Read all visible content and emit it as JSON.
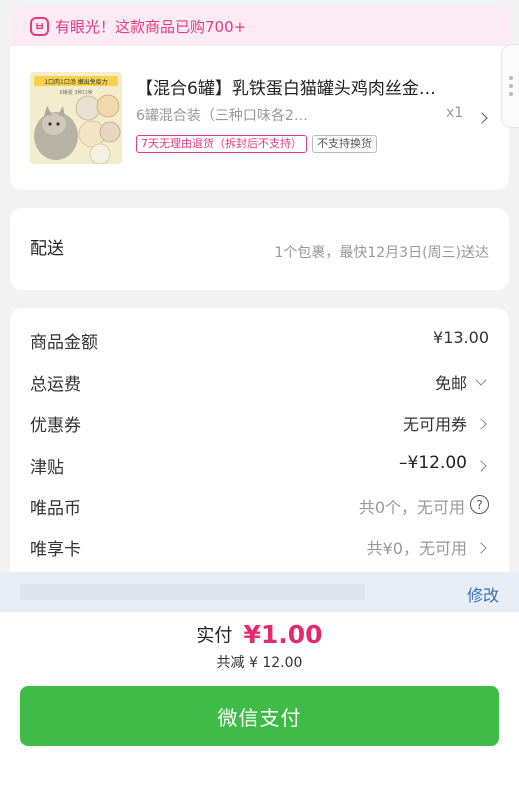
{
  "promo": {
    "icon": "smile-badge-icon",
    "text": "有眼光！这款商品已购700+"
  },
  "product": {
    "title": "【混合6罐】乳铁蛋白猫罐头鸡肉丝金…",
    "spec": "6罐混合装（三种口味各2…",
    "quantity": "x1",
    "tags": [
      "7天无理由退货（拆封后不支持）",
      "不支持换货"
    ],
    "thumb_text": [
      "1口肉1口汤 嫩出免疫力",
      "6罐装 3种口味"
    ]
  },
  "delivery": {
    "label": "配送",
    "info": "1个包裹，最快12月3日(周三)送达"
  },
  "pricing": {
    "goods_amount_label": "商品金额",
    "goods_amount_value": "¥13.00",
    "shipping_label": "总运费",
    "shipping_value": "免邮",
    "coupon_label": "优惠券",
    "coupon_value": "无可用券",
    "allowance_label": "津贴",
    "allowance_value": "–¥12.00",
    "vcoin_label": "唯品币",
    "vcoin_value": "共0个，无可用",
    "vip_card_label": "唯享卡",
    "vip_card_value": "共¥0，无可用"
  },
  "edit": {
    "link": "修改"
  },
  "payment": {
    "total_label": "实付",
    "total_amount": "¥1.00",
    "saved_text": "共减 ¥ 12.00",
    "button_label": "微信支付"
  },
  "colors": {
    "accent_pink": "#e43b86",
    "price_red": "#e6296e",
    "wechat_green": "#3fbb48",
    "link_blue": "#3c6fb5"
  }
}
